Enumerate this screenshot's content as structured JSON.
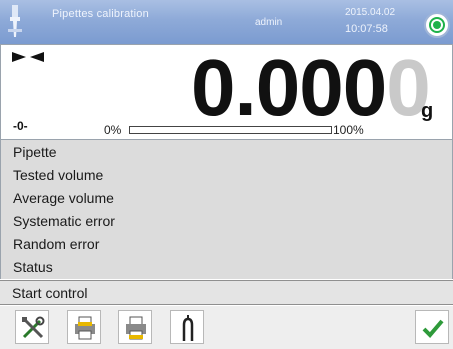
{
  "header": {
    "title": "Pipettes calibration",
    "subtitle": "",
    "user": "admin",
    "date": "2015.04.02",
    "time": "10:07:58",
    "level_status": "level-ok"
  },
  "display": {
    "weight_main": "0.000",
    "weight_last_digit": "0",
    "unit": "g",
    "zero_indicator": "-0-",
    "range_min": "0%",
    "range_max": "100%",
    "load_fraction": 0,
    "stable_indicator": "stable-icon"
  },
  "info_rows": [
    "Pipette",
    "Tested volume",
    "Average volume",
    "Systematic error",
    "Random error",
    "Status"
  ],
  "start_control": "Start control",
  "toolbar": {
    "buttons": [
      "tools-icon",
      "print-header-icon",
      "print-footer-icon",
      "pipette-select-icon",
      "confirm-icon"
    ]
  },
  "colors": {
    "topbar": "#8eaad8",
    "level_ok": "#1fb24a",
    "confirm": "#2e9a3a"
  }
}
